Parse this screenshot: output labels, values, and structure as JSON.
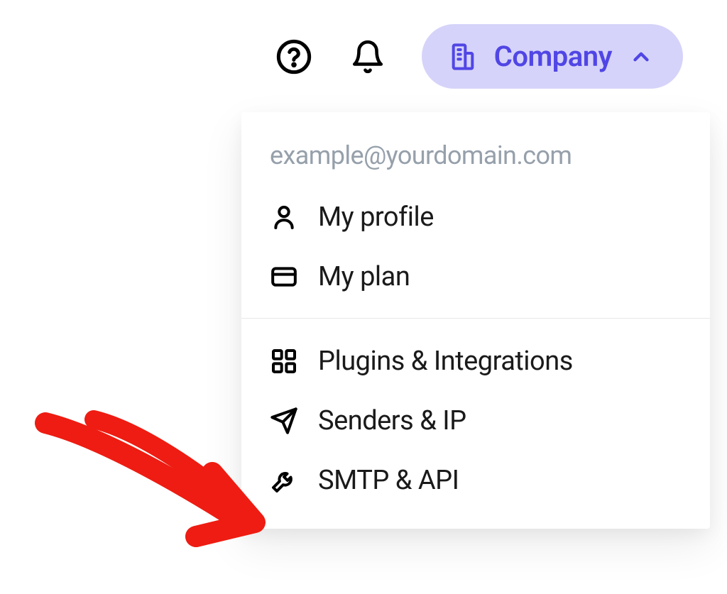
{
  "topbar": {
    "company_label": "Company"
  },
  "dropdown": {
    "email": "example@yourdomain.com",
    "items_group1": [
      {
        "label": "My profile",
        "icon": "user-icon"
      },
      {
        "label": "My plan",
        "icon": "card-icon"
      }
    ],
    "items_group2": [
      {
        "label": "Plugins & Integrations",
        "icon": "grid-icon"
      },
      {
        "label": "Senders & IP",
        "icon": "send-icon"
      },
      {
        "label": "SMTP & API",
        "icon": "wrench-icon"
      }
    ]
  },
  "colors": {
    "accent": "#5046e5",
    "pill_bg": "#d6d3fa",
    "muted": "#96a0ab",
    "annotation": "#ee1c12"
  }
}
